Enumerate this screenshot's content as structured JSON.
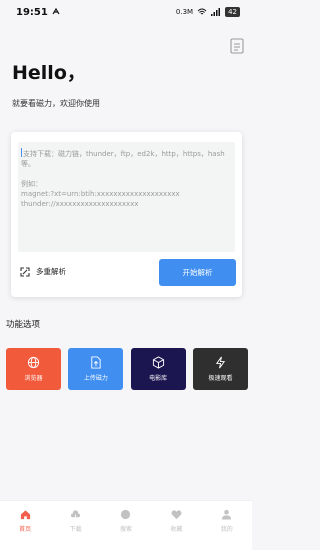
{
  "status": {
    "time": "19:51",
    "network_speed": "0.3M",
    "battery": "42"
  },
  "header": {
    "title": "Hello，",
    "subtitle": "就要看磁力，欢迎你使用"
  },
  "input": {
    "placeholder": "支持下载：磁力链，thunder，ftp，ed2k，http，https，hash等。\n\n例如：\nmagnet:?xt=urn:btih:xxxxxxxxxxxxxxxxxxxx\nthunder://xxxxxxxxxxxxxxxxxxxx"
  },
  "options": {
    "multi_parse_label": "多重解析",
    "start_button": "开始解析"
  },
  "section": {
    "features_title": "功能选项"
  },
  "features": [
    {
      "label": "浏览器",
      "icon": "globe-icon",
      "color": "#f25a3c"
    },
    {
      "label": "上传磁力",
      "icon": "file-upload-icon",
      "color": "#3f8ef0"
    },
    {
      "label": "电影库",
      "icon": "cube-icon",
      "color": "#1b1650"
    },
    {
      "label": "极速观看",
      "icon": "lightning-icon",
      "color": "#2f2f2f"
    }
  ],
  "tabs": [
    {
      "label": "首页",
      "icon": "home-icon",
      "active": true
    },
    {
      "label": "下载",
      "icon": "download-icon",
      "active": false
    },
    {
      "label": "搜索",
      "icon": "search-icon",
      "active": false
    },
    {
      "label": "收藏",
      "icon": "heart-icon",
      "active": false
    },
    {
      "label": "我的",
      "icon": "user-icon",
      "active": false
    }
  ],
  "colors": {
    "accent": "#3f8ef0",
    "tab_active": "#f25f4c",
    "tab_inactive": "#c2c2c2"
  }
}
